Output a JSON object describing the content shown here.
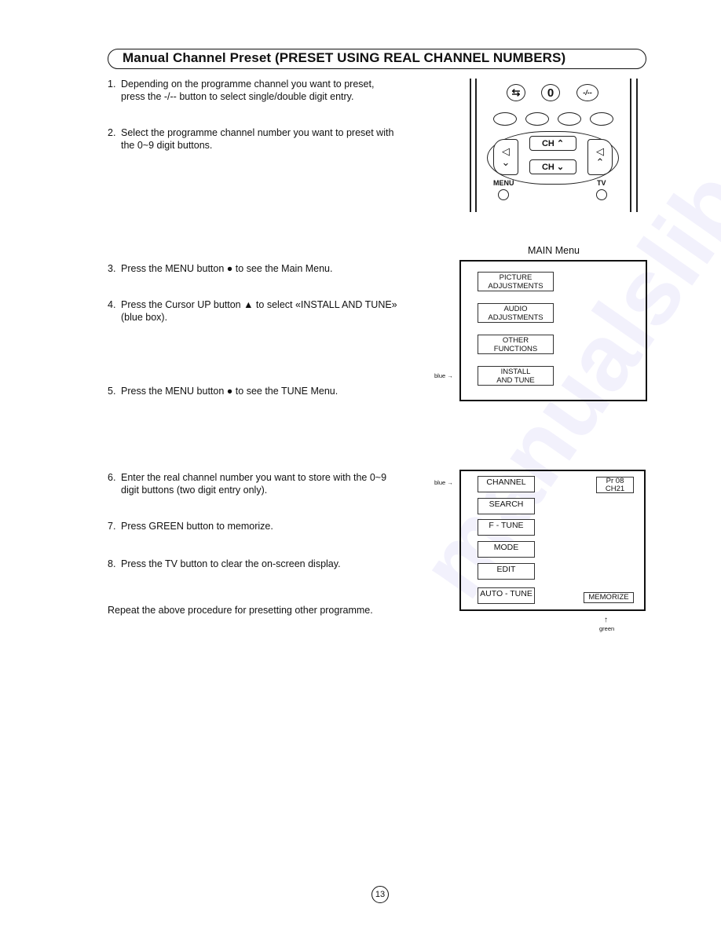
{
  "title": "Manual Channel Preset (PRESET USING REAL CHANNEL NUMBERS)",
  "steps": [
    {
      "num": "1.",
      "line1": "Depending on the programme channel you want to preset,",
      "line2": "press the -/-- button to select single/double digit entry."
    },
    {
      "num": "2.",
      "line1": "Select the programme channel number you want to preset with",
      "line2": "the 0~9 digit buttons."
    },
    {
      "num": "3.",
      "line1": "Press the MENU button ● to see the Main Menu.",
      "line2": ""
    },
    {
      "num": "4.",
      "line1": "Press the Cursor UP button ▲ to select «INSTALL AND TUNE»",
      "line2": "(blue box)."
    },
    {
      "num": "5.",
      "line1": "Press the MENU button ● to see the TUNE Menu.",
      "line2": ""
    },
    {
      "num": "6.",
      "line1": "Enter the real channel number you want to store with the 0~9",
      "line2": "digit buttons (two digit entry only)."
    },
    {
      "num": "7.",
      "line1": "Press GREEN button to memorize.",
      "line2": ""
    },
    {
      "num": "8.",
      "line1": "Press the TV button to clear the on-screen display.",
      "line2": ""
    }
  ],
  "repeat_note": "Repeat the above procedure for presetting other programme.",
  "remote": {
    "top_buttons": [
      {
        "icon": "swap-icon",
        "glyph": "⇆"
      },
      {
        "icon": "zero-button",
        "glyph": "0"
      },
      {
        "icon": "digit-mode-icon",
        "glyph": "-/--"
      }
    ],
    "color_buttons": [
      "red",
      "green",
      "yellow",
      "blue"
    ],
    "ch_up": "CH",
    "ch_down": "CH",
    "menu_label": "MENU",
    "tv_label": "TV"
  },
  "main_menu": {
    "caption": "MAIN Menu",
    "pointer_label": "blue →",
    "items": [
      {
        "line1": "PICTURE",
        "line2": "ADJUSTMENTS"
      },
      {
        "line1": "AUDIO",
        "line2": "ADJUSTMENTS"
      },
      {
        "line1": "OTHER",
        "line2": "FUNCTIONS"
      },
      {
        "line1": "INSTALL",
        "line2": "AND TUNE"
      }
    ]
  },
  "tune_menu": {
    "pointer_label": "blue →",
    "items": [
      "CHANNEL",
      "SEARCH",
      "F - TUNE",
      "MODE",
      "EDIT",
      "AUTO - TUNE"
    ],
    "status": {
      "line1": "Pr 08",
      "line2": "CH21"
    },
    "memorize": "MEMORIZE",
    "green_arrow": "↑",
    "green_label": "green"
  },
  "page_number": "13"
}
